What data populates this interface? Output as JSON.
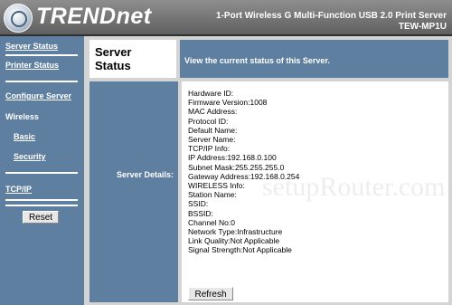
{
  "header": {
    "brand": "TRENDnet",
    "product_name": "1-Port Wireless G Multi-Function USB 2.0 Print Server",
    "model": "TEW-MP1U"
  },
  "sidebar": {
    "items": [
      {
        "label": "Server Status",
        "link": true
      },
      {
        "label": "Printer Status",
        "link": true
      },
      {
        "label": "Configure Server",
        "link": true
      },
      {
        "label": "Wireless",
        "link": false
      },
      {
        "label": "Basic",
        "link": true
      },
      {
        "label": "Security",
        "link": true
      },
      {
        "label": "TCP/IP",
        "link": true
      }
    ],
    "reset_label": "Reset"
  },
  "main": {
    "title": "Server Status",
    "description": "View the current status of this Server.",
    "details_label": "Server Details:",
    "details": [
      "Hardware ID:",
      "Firmware Version:1008",
      "MAC Address:",
      "Protocol ID:",
      "Default Name:",
      "Server Name:",
      "TCP/IP Info:",
      "IP Address:192.168.0.100",
      "Subnet Mask:255.255.255.0",
      "Gateway Address:192.168.0.254",
      "WIRELESS Info:",
      "Station Name:",
      "SSID:",
      "BSSID:",
      "Channel No:0",
      "Network Type:Infrastructure",
      "Link Quality:Not Applicable",
      "Signal Strength:Not Applicable"
    ],
    "refresh_label": "Refresh"
  },
  "watermark": "setupRouter.com",
  "colors": {
    "sidebar_bg": "#5e7f9f",
    "header_bg": "#6f6f6f",
    "panel_bg": "#d4d4d4"
  }
}
